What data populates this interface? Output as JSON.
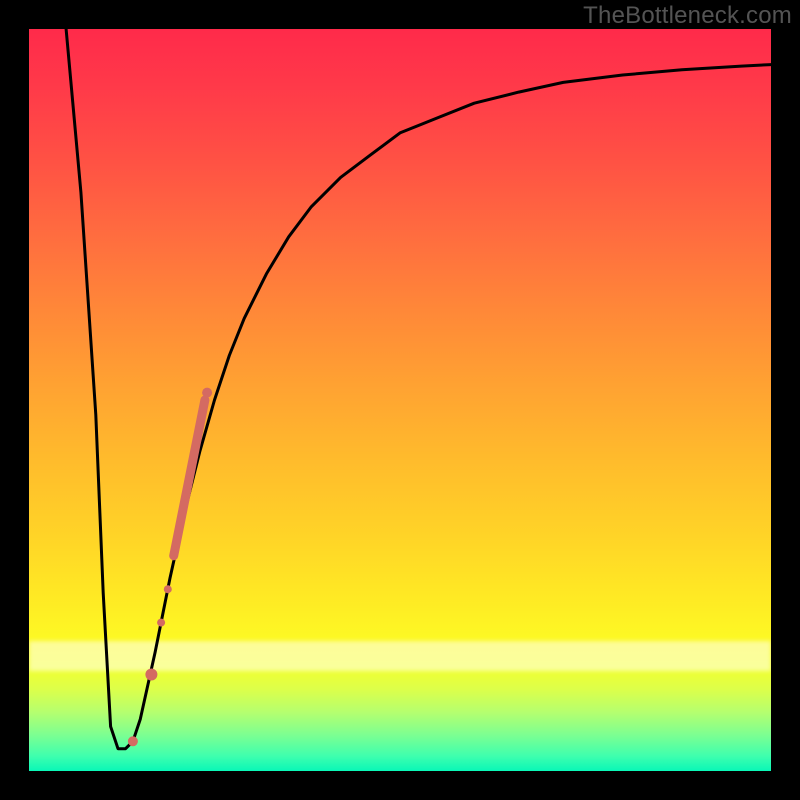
{
  "watermark": "TheBottleneck.com",
  "colors": {
    "frame": "#000000",
    "curve": "#000000",
    "marker_fill": "#d46a62",
    "marker_stroke": "#d46a62",
    "gradient_top": "#ff2a4a",
    "gradient_bottom": "#09f7b7"
  },
  "chart_data": {
    "type": "line",
    "title": "",
    "xlabel": "",
    "ylabel": "",
    "xlim": [
      0,
      100
    ],
    "ylim": [
      0,
      100
    ],
    "series": [
      {
        "name": "curve",
        "x": [
          5,
          7,
          9,
          10,
          11,
          12,
          13,
          14,
          15,
          17,
          19,
          21,
          23,
          25,
          27,
          29,
          32,
          35,
          38,
          42,
          46,
          50,
          55,
          60,
          66,
          72,
          80,
          88,
          96,
          100
        ],
        "y": [
          100,
          78,
          48,
          24,
          6,
          3,
          3,
          4,
          7,
          16,
          26,
          35,
          43,
          50,
          56,
          61,
          67,
          72,
          76,
          80,
          83,
          86,
          88,
          90,
          91.5,
          92.8,
          93.8,
          94.5,
          95,
          95.2
        ]
      }
    ],
    "markers": [
      {
        "shape": "circle",
        "x": 14.0,
        "y": 4.0,
        "r": 5
      },
      {
        "shape": "circle",
        "x": 16.5,
        "y": 13.0,
        "r": 6
      },
      {
        "shape": "circle",
        "x": 17.8,
        "y": 20.0,
        "r": 4
      },
      {
        "shape": "circle",
        "x": 18.7,
        "y": 24.5,
        "r": 4
      },
      {
        "shape": "segment",
        "x1": 19.5,
        "y1": 29.0,
        "x2": 23.7,
        "y2": 50.0,
        "w": 9
      },
      {
        "shape": "circle",
        "x": 24.0,
        "y": 51.0,
        "r": 5
      }
    ]
  }
}
